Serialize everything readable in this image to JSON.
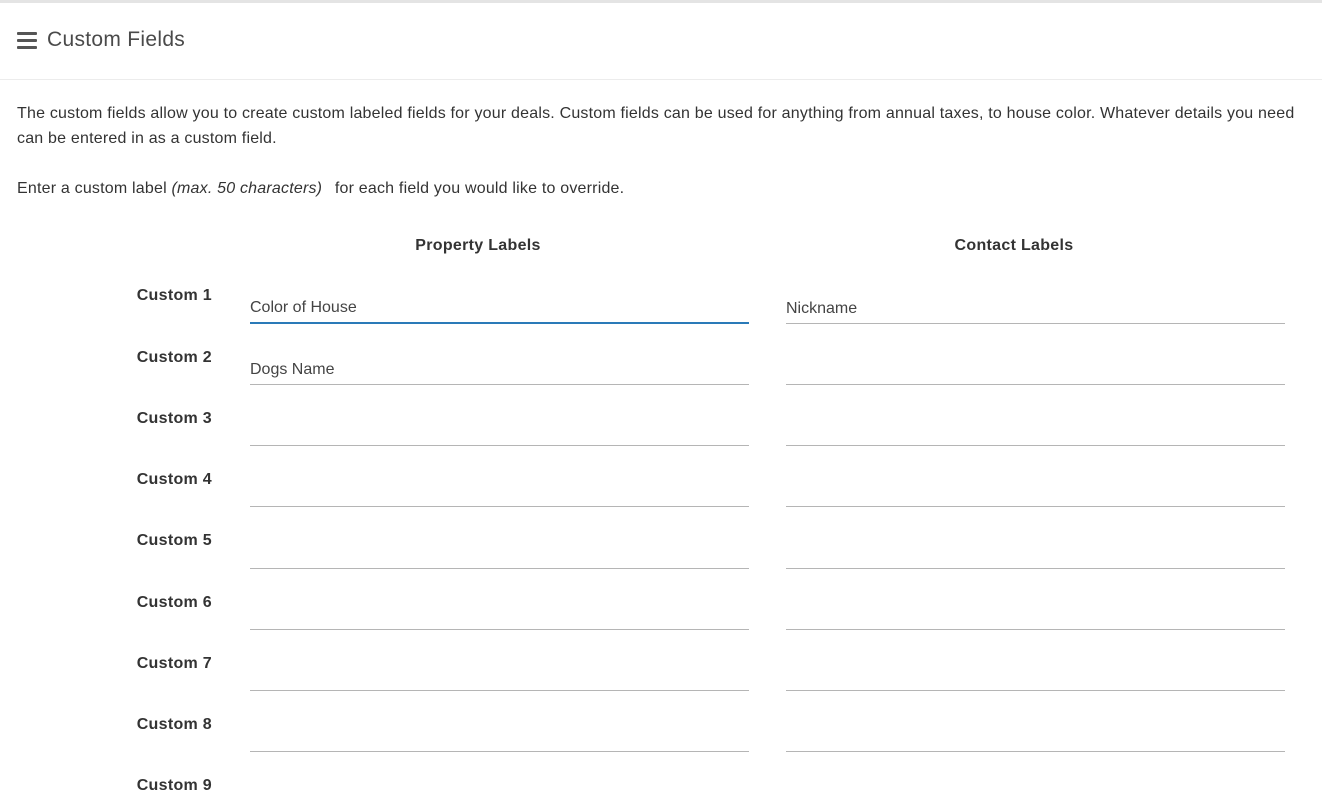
{
  "header": {
    "title": "Custom Fields",
    "menu_icon": "hamburger-menu-icon"
  },
  "intro": {
    "paragraph": "The custom fields allow you to create custom labeled fields for your deals. Custom fields can be used for anything from annual taxes, to house color. Whatever details you need can be entered in as a custom field.",
    "instruction_before": "Enter a custom label ",
    "instruction_hint": "(max. 50 characters)",
    "instruction_after": " for each field you would like to override."
  },
  "columns": {
    "property": "Property Labels",
    "contact": "Contact Labels"
  },
  "rows": [
    {
      "label": "Custom 1",
      "property_value": "Color of House",
      "contact_value": "Nickname"
    },
    {
      "label": "Custom 2",
      "property_value": "Dogs Name",
      "contact_value": ""
    },
    {
      "label": "Custom 3",
      "property_value": "",
      "contact_value": ""
    },
    {
      "label": "Custom 4",
      "property_value": "",
      "contact_value": ""
    },
    {
      "label": "Custom 5",
      "property_value": "",
      "contact_value": ""
    },
    {
      "label": "Custom 6",
      "property_value": "",
      "contact_value": ""
    },
    {
      "label": "Custom 7",
      "property_value": "",
      "contact_value": ""
    },
    {
      "label": "Custom 8",
      "property_value": "",
      "contact_value": ""
    },
    {
      "label": "Custom 9",
      "property_value": "",
      "contact_value": ""
    }
  ],
  "colors": {
    "focus_accent": "#2a7ab8",
    "field_border": "#b5b5b5"
  }
}
